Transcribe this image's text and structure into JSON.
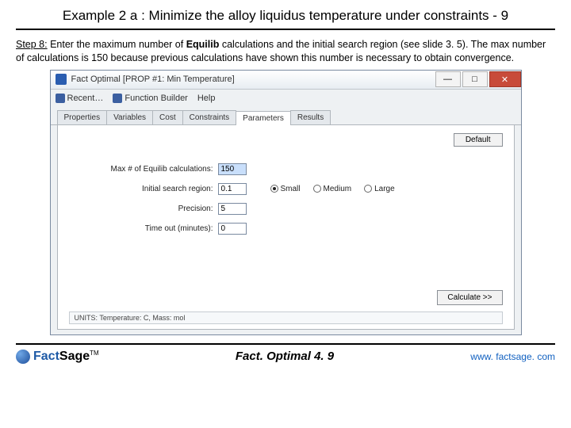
{
  "slide": {
    "title": "Example 2 a : Minimize the alloy liquidus temperature under constraints - 9",
    "step_label": "Step 8:",
    "step_text_1": " Enter the maximum number of ",
    "step_bold": "Equilib",
    "step_text_2": " calculations and the initial search region (see slide 3. 5). The max number of calculations is 150 because previous calculations have shown this number is necessary to obtain convergence.",
    "footer_center": "Fact. Optimal   4. 9",
    "footer_url": "www. factsage. com",
    "logo_fact": "Fact",
    "logo_sage": "Sage",
    "logo_tm": "TM"
  },
  "app": {
    "title": "Fact Optimal   [PROP #1: Min Temperature]",
    "menu": {
      "recent": "Recent…",
      "fb": "Function Builder",
      "help": "Help"
    },
    "tabs": [
      "Properties",
      "Variables",
      "Cost",
      "Constraints",
      "Parameters",
      "Results"
    ],
    "active_tab_index": 4,
    "default_btn": "Default",
    "calc_btn": "Calculate >>",
    "labels": {
      "max": "Max # of Equilib calculations:",
      "region": "Initial search region:",
      "precision": "Precision:",
      "timeout": "Time out (minutes):"
    },
    "values": {
      "max": "150",
      "region": "0.1",
      "precision": "5",
      "timeout": "0"
    },
    "radios": {
      "small": "Small",
      "medium": "Medium",
      "large": "Large"
    },
    "status": "UNITS:   Temperature: C,  Mass: mol"
  }
}
